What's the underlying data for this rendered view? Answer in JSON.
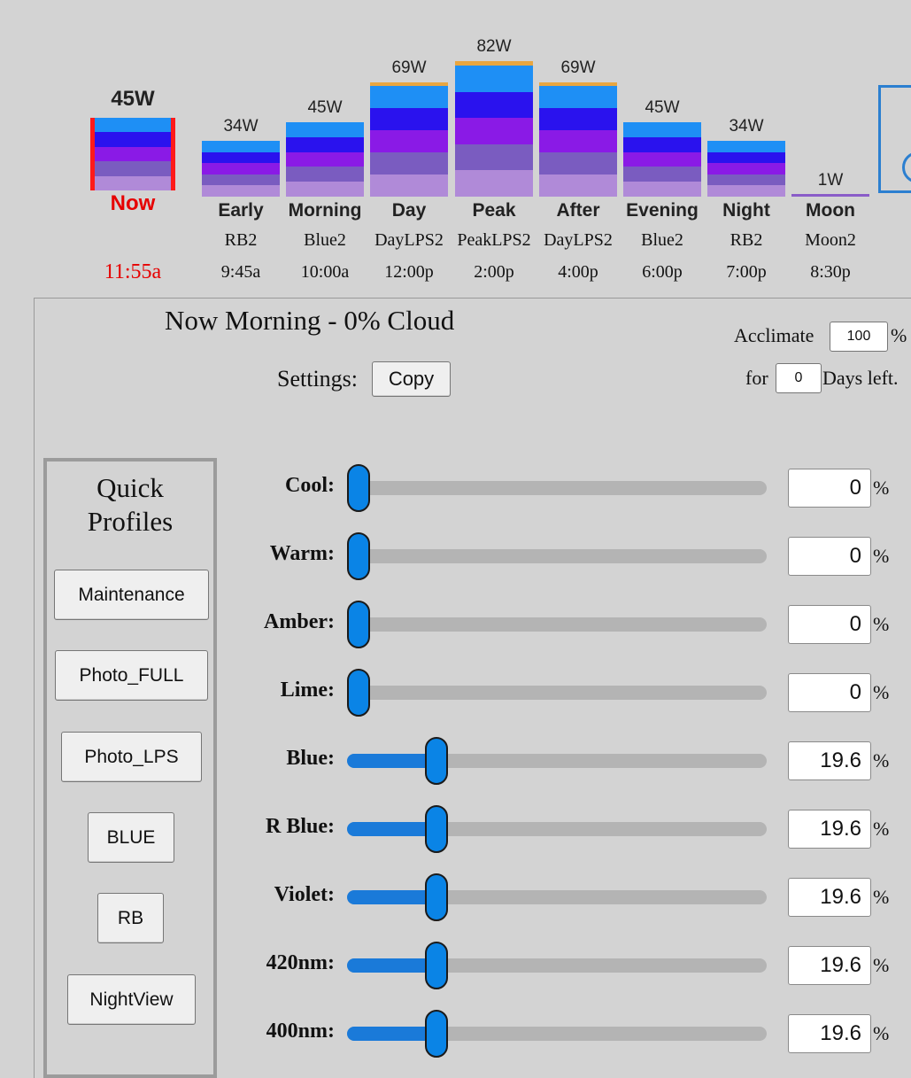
{
  "now": {
    "watts": "45W",
    "label": "Now",
    "time": "11:55a",
    "time_color": "#e60000"
  },
  "schedule": [
    {
      "watts": "34W",
      "name": "Early",
      "preset": "RB2",
      "time": "9:45a"
    },
    {
      "watts": "45W",
      "name": "Morning",
      "preset": "Blue2",
      "time": "10:00a"
    },
    {
      "watts": "69W",
      "name": "Day",
      "preset": "DayLPS2",
      "time": "12:00p"
    },
    {
      "watts": "82W",
      "name": "Peak",
      "preset": "PeakLPS2",
      "time": "2:00p"
    },
    {
      "watts": "69W",
      "name": "After",
      "preset": "DayLPS2",
      "time": "4:00p"
    },
    {
      "watts": "45W",
      "name": "Evening",
      "preset": "Blue2",
      "time": "6:00p"
    },
    {
      "watts": "34W",
      "name": "Night",
      "preset": "RB2",
      "time": "7:00p"
    },
    {
      "watts": "1W",
      "name": "Moon",
      "preset": "Moon2",
      "time": "8:30p"
    }
  ],
  "panel": {
    "title": "Now Morning - 0% Cloud",
    "settings_label": "Settings:",
    "copy_button": "Copy",
    "acclimate_label": "Acclimate",
    "acclimate_value": "100",
    "acclimate_unit": "%",
    "for_label": "for",
    "days_value": "0",
    "days_label": "Days left."
  },
  "quick_profiles": {
    "title_line1": "Quick",
    "title_line2": "Profiles",
    "buttons": [
      "Maintenance",
      "Photo_FULL",
      "Photo_LPS",
      "BLUE",
      "RB",
      "NightView"
    ]
  },
  "channels": [
    {
      "label": "Cool:",
      "value": "0",
      "level": 0
    },
    {
      "label": "Warm:",
      "value": "0",
      "level": 0
    },
    {
      "label": "Amber:",
      "value": "0",
      "level": 0
    },
    {
      "label": "Lime:",
      "value": "0",
      "level": 0
    },
    {
      "label": "Blue:",
      "value": "19.6",
      "level": 0.196
    },
    {
      "label": "R Blue:",
      "value": "19.6",
      "level": 0.196
    },
    {
      "label": "Violet:",
      "value": "19.6",
      "level": 0.196
    },
    {
      "label": "420nm:",
      "value": "19.6",
      "level": 0.196
    },
    {
      "label": "400nm:",
      "value": "19.6",
      "level": 0.196
    }
  ],
  "percent_unit": "%",
  "colors": {
    "accent": "#0a84e6",
    "bar_blue": "#1e8ff5",
    "bar_royal": "#2a12ee",
    "bar_violet": "#8a1ae6",
    "bar_purple": "#7a5cc0",
    "bar_lavender": "#b08ad8",
    "now_border": "#ff1a1a"
  }
}
